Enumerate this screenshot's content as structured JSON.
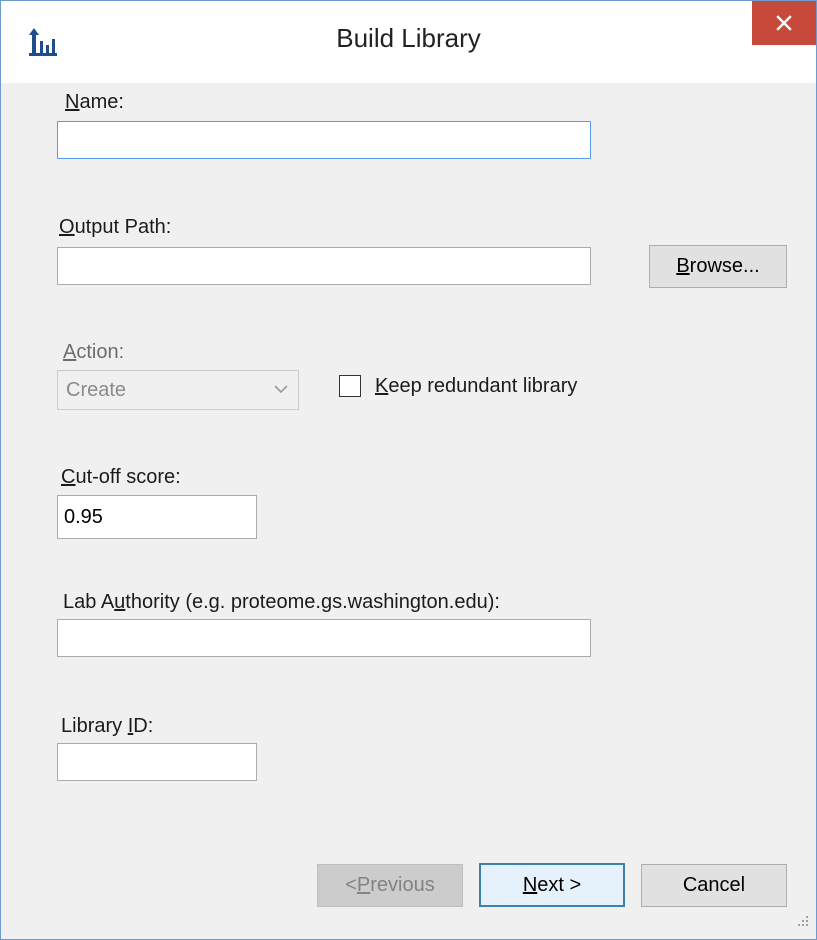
{
  "window": {
    "title": "Build Library",
    "icon": "peptide-library-icon",
    "close_icon": "close-icon"
  },
  "fields": {
    "name_label_hotkey": "N",
    "name_label_rest": "ame:",
    "name_value": "",
    "output_label_hotkey": "O",
    "output_label_rest": "utput Path:",
    "output_value": "",
    "action_label_hotkey": "A",
    "action_label_rest": "ction:",
    "action_selected": "Create",
    "keep_redundant_hotkey": "K",
    "keep_redundant_rest": "eep redundant library",
    "keep_redundant_checked": false,
    "cutoff_label_hotkey": "C",
    "cutoff_label_rest": "ut-off score:",
    "cutoff_value": "0.95",
    "lab_label_pre": "Lab A",
    "lab_label_hotkey": "u",
    "lab_label_post": "thority (e.g. proteome.gs.washington.edu):",
    "lab_value": "",
    "libid_label_pre": "Library ",
    "libid_label_hotkey": "I",
    "libid_label_post": "D:",
    "libid_value": ""
  },
  "buttons": {
    "browse_hotkey": "B",
    "browse_rest": "rowse...",
    "previous_pre": "< ",
    "previous_hotkey": "P",
    "previous_rest": "revious",
    "next_hotkey": "N",
    "next_rest": "ext >",
    "cancel": "Cancel"
  },
  "colors": {
    "close_button": "#c7493a",
    "focus_border": "#569de5",
    "default_button_border": "#3c7fb1"
  }
}
